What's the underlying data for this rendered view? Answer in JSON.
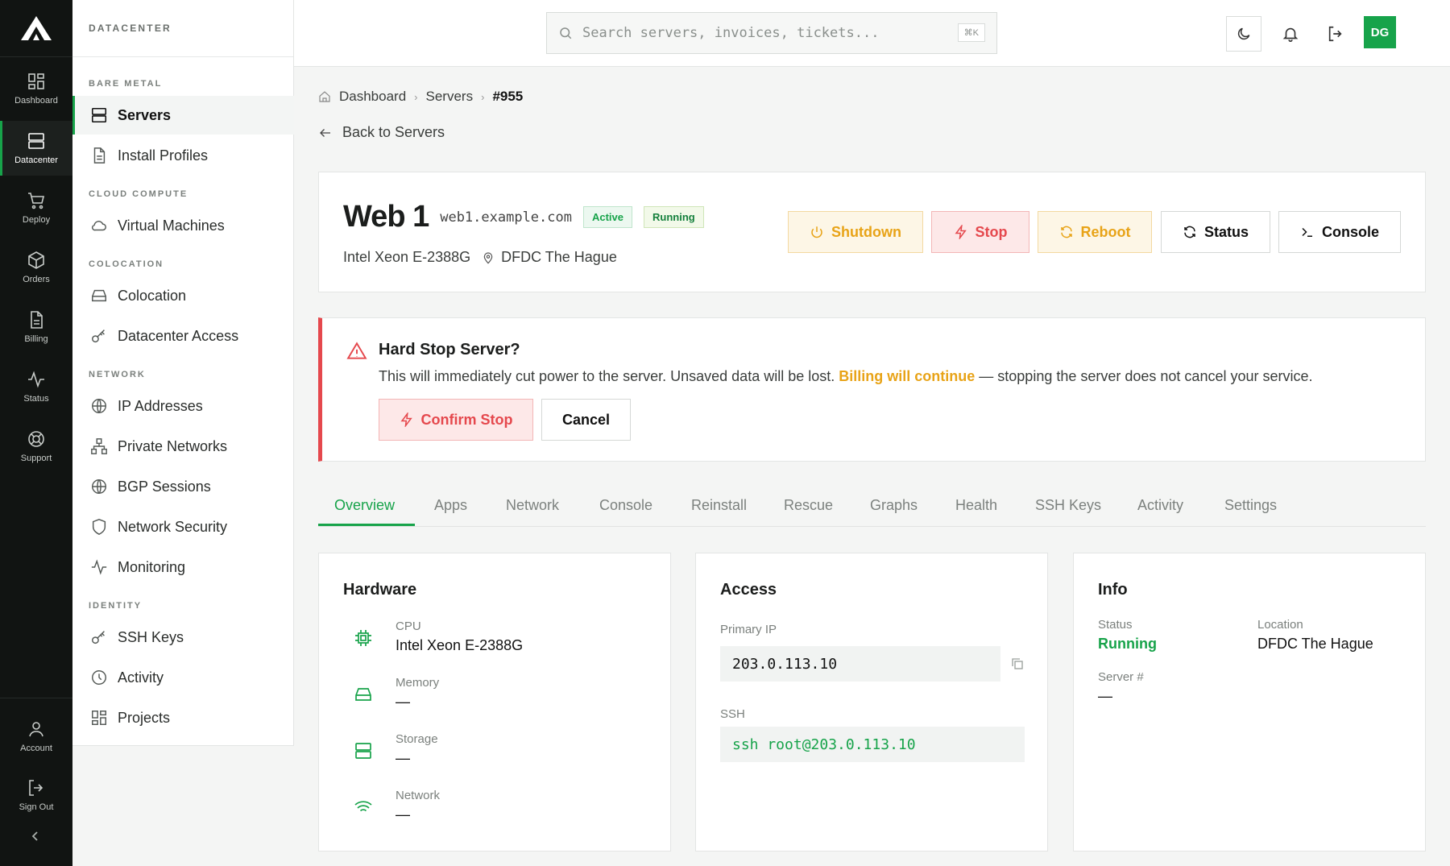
{
  "rail": {
    "items": [
      {
        "label": "Dashboard",
        "icon": "dashboard-icon"
      },
      {
        "label": "Datacenter",
        "icon": "server-icon"
      },
      {
        "label": "Deploy",
        "icon": "cart-icon"
      },
      {
        "label": "Orders",
        "icon": "box-icon"
      },
      {
        "label": "Billing",
        "icon": "document-icon"
      },
      {
        "label": "Status",
        "icon": "activity-icon"
      },
      {
        "label": "Support",
        "icon": "lifebuoy-icon"
      }
    ],
    "account": "Account",
    "signout": "Sign Out"
  },
  "sidebar": {
    "title": "DATACENTER",
    "sections": {
      "bare_metal": "BARE METAL",
      "cloud": "CLOUD COMPUTE",
      "colocation": "COLOCATION",
      "network": "NETWORK",
      "identity": "IDENTITY"
    },
    "items": {
      "servers": "Servers",
      "install_profiles": "Install Profiles",
      "vms": "Virtual Machines",
      "colocation": "Colocation",
      "dc_access": "Datacenter Access",
      "ip": "IP Addresses",
      "private_networks": "Private Networks",
      "bgp": "BGP Sessions",
      "net_security": "Network Security",
      "monitoring": "Monitoring",
      "ssh_keys": "SSH Keys",
      "activity": "Activity",
      "projects": "Projects"
    }
  },
  "topbar": {
    "search_placeholder": "Search servers, invoices, tickets...",
    "shortcut": "⌘K",
    "avatar": "DG"
  },
  "breadcrumb": {
    "dashboard": "Dashboard",
    "servers": "Servers",
    "current": "#955",
    "sep": "›"
  },
  "back_label": "Back to Servers",
  "server": {
    "name": "Web 1",
    "hostname": "web1.example.com",
    "badge_active": "Active",
    "badge_running": "Running",
    "cpu": "Intel Xeon E-2388G",
    "location": "DFDC The Hague"
  },
  "actions": {
    "shutdown": "Shutdown",
    "stop": "Stop",
    "reboot": "Reboot",
    "status": "Status",
    "console": "Console"
  },
  "alert": {
    "title": "Hard Stop Server?",
    "text_before": "This will immediately cut power to the server. Unsaved data will be lost.",
    "highlight": "Billing will continue",
    "text_after": "— stopping the server does not cancel your service.",
    "confirm": "Confirm Stop",
    "cancel": "Cancel"
  },
  "tabs": [
    "Overview",
    "Apps",
    "Network",
    "Console",
    "Reinstall",
    "Rescue",
    "Graphs",
    "Health",
    "SSH Keys",
    "Activity",
    "Settings"
  ],
  "hardware": {
    "title": "Hardware",
    "cpu_label": "CPU",
    "cpu_value": "Intel Xeon E-2388G",
    "memory_label": "Memory",
    "memory_value": "—",
    "storage_label": "Storage",
    "storage_value": "—",
    "network_label": "Network",
    "network_value": "—"
  },
  "access": {
    "title": "Access",
    "ip_label": "Primary IP",
    "ip_value": "203.0.113.10",
    "ssh_label": "SSH",
    "ssh_value": "ssh root@203.0.113.10"
  },
  "info": {
    "title": "Info",
    "status_label": "Status",
    "status_value": "Running",
    "location_label": "Location",
    "location_value": "DFDC The Hague",
    "server_label": "Server #",
    "server_value": "—"
  },
  "colors": {
    "accent": "#17a34a",
    "danger": "#e5484d",
    "warning": "#e8a317",
    "rail": "#111412"
  }
}
